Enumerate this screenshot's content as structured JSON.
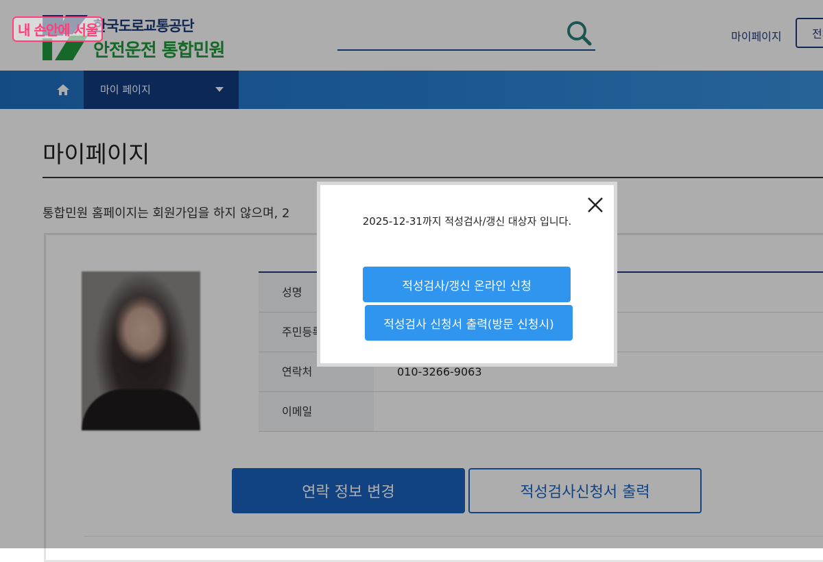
{
  "header": {
    "watermark": "내 손안에 서울",
    "logo_top": "한국도로교통공단",
    "logo_main": "안전운전 통합민원",
    "search_icon": "search-icon",
    "mypage_link": "마이페이지",
    "right_button": "전체"
  },
  "nav": {
    "home_icon": "home-icon",
    "current_menu": "마이 페이지"
  },
  "content": {
    "page_title": "마이페이지",
    "intro_text": "통합민원 홈페이지는 회원가입을 하지 않으며, 2",
    "table": [
      {
        "label": "성명",
        "value": ""
      },
      {
        "label": "주민등록",
        "value": ""
      },
      {
        "label": "연락처",
        "value": "010-3266-9063"
      },
      {
        "label": "이메일",
        "value": ""
      }
    ],
    "btn_change_contact": "연락 정보 변경",
    "btn_print_form": "적성검사신청서 출력"
  },
  "modal": {
    "message": "2025-12-31까지 적성검사/갱신 대상자 입니다.",
    "btn_online": "적성검사/갱신 온라인 신청",
    "btn_print": "적성검사 신청서 출력(방문 신청시)",
    "close_icon": "close-icon"
  }
}
